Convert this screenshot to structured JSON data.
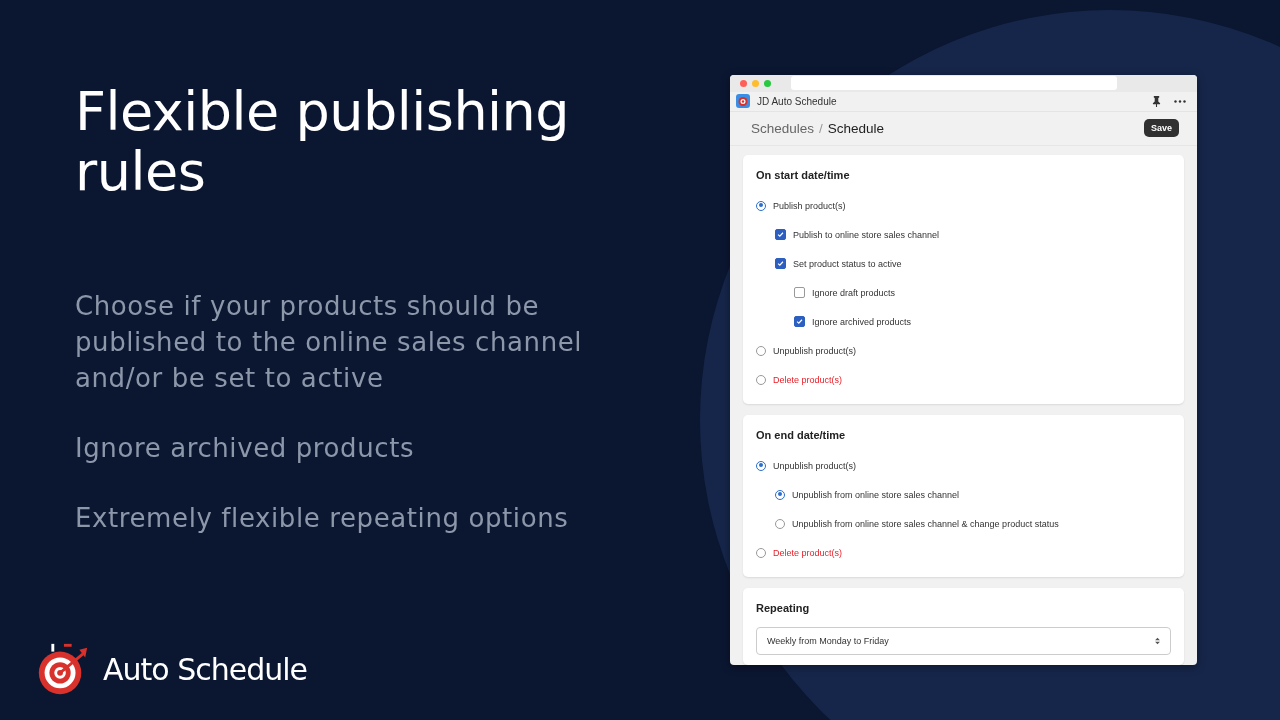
{
  "slide": {
    "title": "Flexible publishing rules",
    "points": [
      "Choose if your products should be published to the online sales channel and/or be set to active",
      "Ignore archived products",
      "Extremely flexible repeating options"
    ],
    "brand": "Auto Schedule"
  },
  "window": {
    "app_title": "JD Auto Schedule",
    "breadcrumb": [
      "Schedules",
      "Schedule"
    ],
    "breadcrumb_separator": "/",
    "save_button": "Save"
  },
  "sections": [
    {
      "title": "On start date/time",
      "options": [
        {
          "kind": "radio",
          "label": "Publish product(s)",
          "selected": true,
          "destructive": false,
          "children": [
            {
              "kind": "checkbox",
              "label": "Publish to online store sales channel",
              "checked": true
            },
            {
              "kind": "checkbox",
              "label": "Set product status to active",
              "checked": true,
              "children": [
                {
                  "kind": "checkbox",
                  "label": "Ignore draft products",
                  "checked": false
                },
                {
                  "kind": "checkbox",
                  "label": "Ignore archived products",
                  "checked": true
                }
              ]
            }
          ]
        },
        {
          "kind": "radio",
          "label": "Unpublish product(s)",
          "selected": false,
          "destructive": false
        },
        {
          "kind": "radio",
          "label": "Delete product(s)",
          "selected": false,
          "destructive": true
        }
      ]
    },
    {
      "title": "On end date/time",
      "options": [
        {
          "kind": "radio",
          "label": "Unpublish product(s)",
          "selected": true,
          "destructive": false,
          "children": [
            {
              "kind": "radio",
              "label": "Unpublish from online store sales channel",
              "selected": true
            },
            {
              "kind": "radio",
              "label": "Unpublish from online store sales channel & change product status",
              "selected": false
            }
          ]
        },
        {
          "kind": "radio",
          "label": "Delete product(s)",
          "selected": false,
          "destructive": true
        }
      ]
    },
    {
      "title": "Repeating",
      "select": {
        "value": "Weekly from Monday to Friday"
      }
    }
  ]
}
